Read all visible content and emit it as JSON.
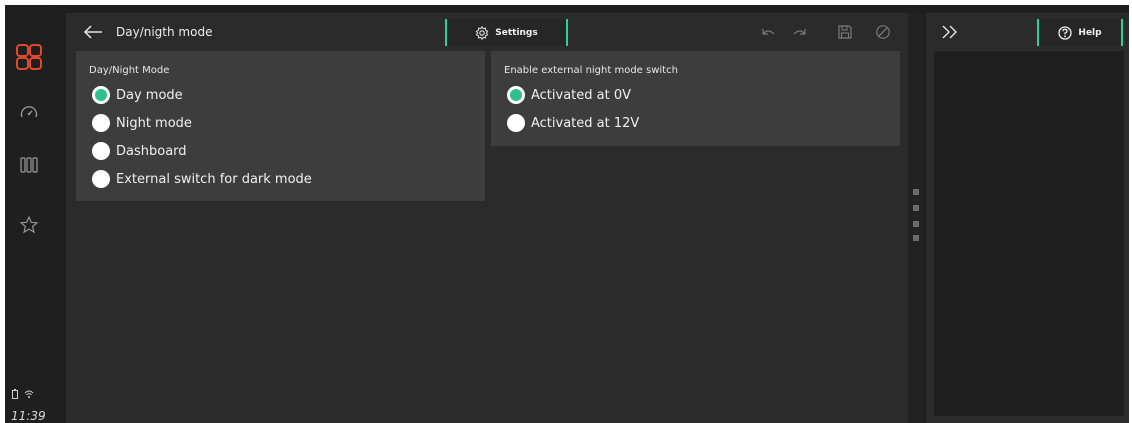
{
  "header": {
    "title": "Day/nigth mode",
    "settings_label": "Settings",
    "help_label": "Help"
  },
  "status": {
    "time": "11:39"
  },
  "rail": {
    "items": [
      "apps-icon",
      "dashboard-gauge-icon",
      "columns-icon",
      "favorites-star-icon"
    ],
    "accent_color": "#e0492a"
  },
  "day_night_panel": {
    "title": "Day/Night Mode",
    "options": [
      {
        "label": "Day mode",
        "selected": true
      },
      {
        "label": "Night mode",
        "selected": false
      },
      {
        "label": "Dashboard",
        "selected": false
      },
      {
        "label": "External switch for dark mode",
        "selected": false
      }
    ]
  },
  "external_switch_panel": {
    "title": "Enable external night mode switch",
    "options": [
      {
        "label": "Activated at 0V",
        "selected": true
      },
      {
        "label": "Activated at 12V",
        "selected": false
      }
    ]
  },
  "colors": {
    "accent": "#2fcf9a",
    "radio_selected": "#2fc08b",
    "panel_bg": "#3d3d3d",
    "main_bg": "#2b2b2b"
  }
}
